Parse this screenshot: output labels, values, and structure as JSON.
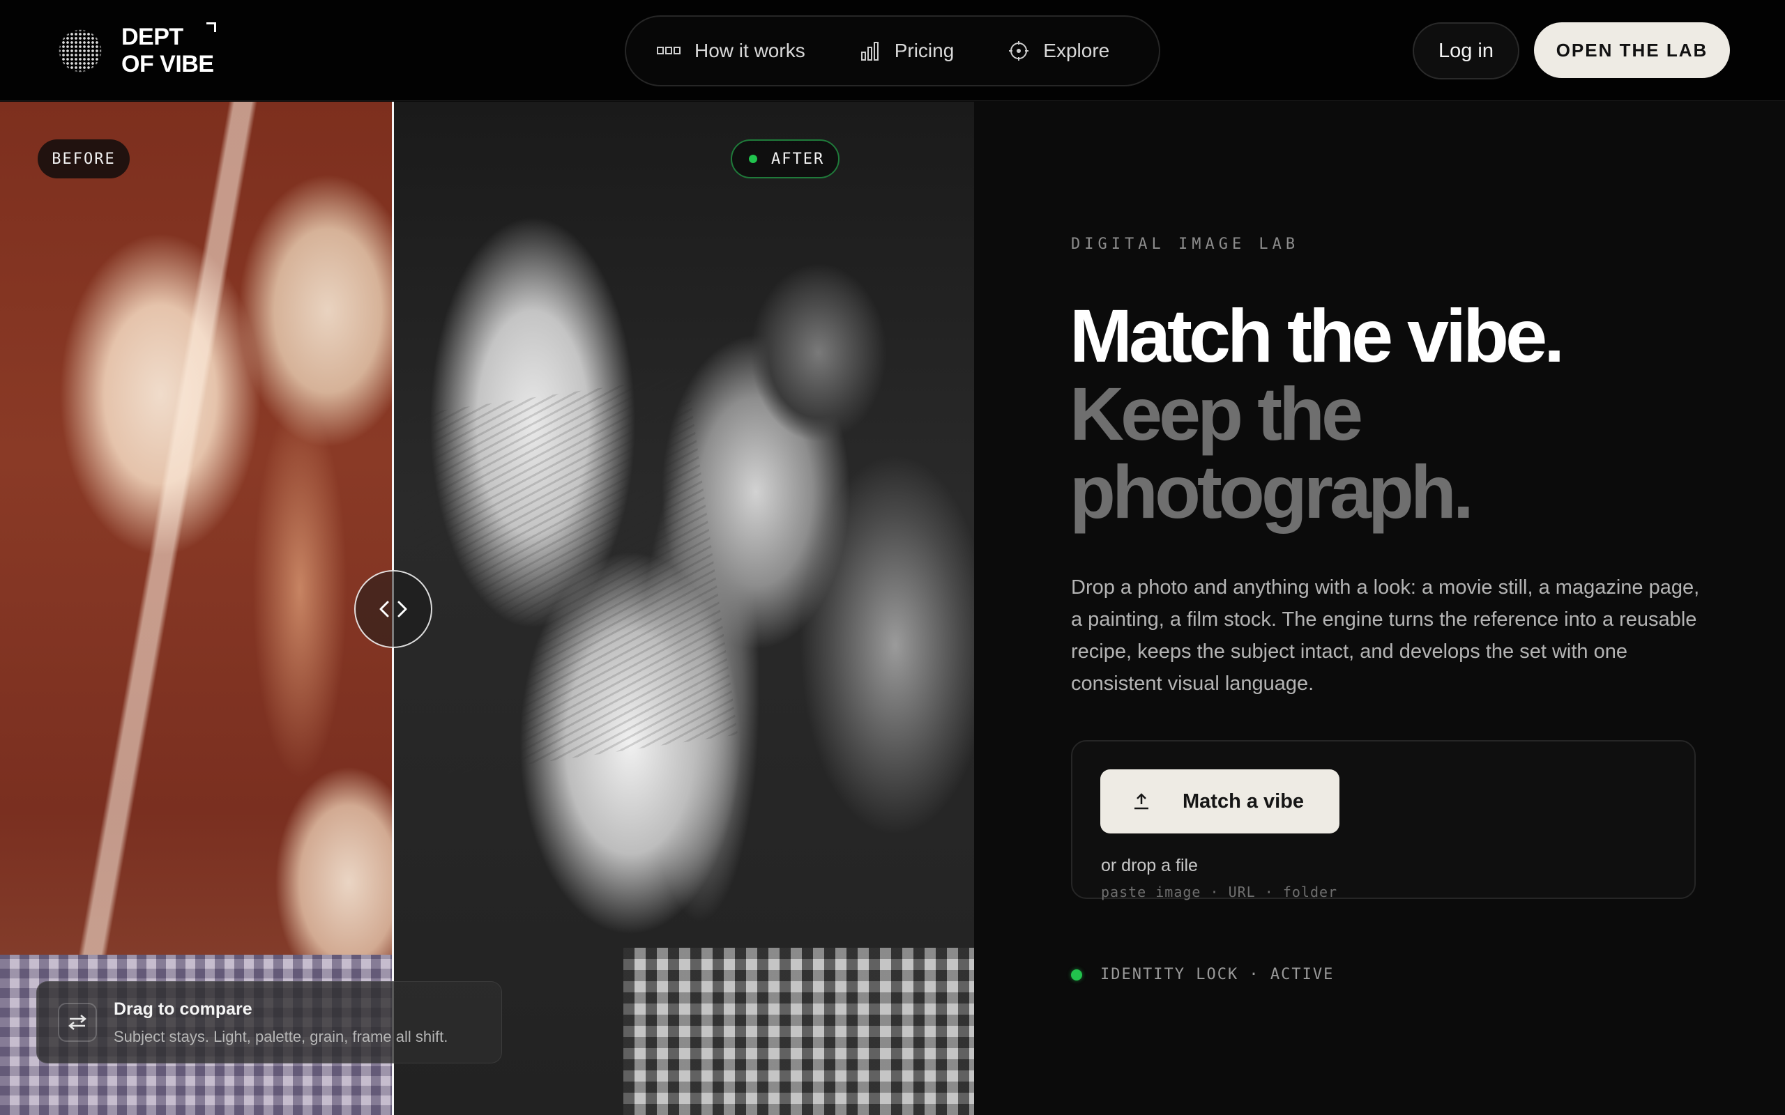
{
  "brand": {
    "line1": "DEPT",
    "line2": "OF VIBE"
  },
  "nav": {
    "items": [
      {
        "label": "How it works",
        "icon": "steps-icon"
      },
      {
        "label": "Pricing",
        "icon": "bar-chart-icon"
      },
      {
        "label": "Explore",
        "icon": "target-icon"
      }
    ]
  },
  "header_actions": {
    "login_label": "Log in",
    "cta_label": "OPEN THE LAB"
  },
  "compare": {
    "before_label": "BEFORE",
    "after_label": "AFTER",
    "hint_title": "Drag to compare",
    "hint_subtitle": "Subject stays. Light, palette, grain, frame all shift."
  },
  "hero": {
    "eyebrow": "DIGITAL IMAGE LAB",
    "headline_line1": "Match the vibe.",
    "headline_line2a": "Keep the",
    "headline_line2b": "photograph.",
    "description": "Drop a photo and anything with a look: a movie still, a magazine page, a painting, a film stock. The engine turns the reference into a reusable recipe, keeps the subject intact, and develops the set with one consistent visual language."
  },
  "upload": {
    "button_label": "Match a vibe",
    "drop_text": "or drop a file",
    "drop_options": "paste image · URL · folder"
  },
  "status": {
    "text": "IDENTITY LOCK · ACTIVE",
    "color": "#22c24d"
  },
  "colors": {
    "accent_light": "#eeebe4",
    "status_green": "#22c24d",
    "background": "#0b0b0b"
  }
}
